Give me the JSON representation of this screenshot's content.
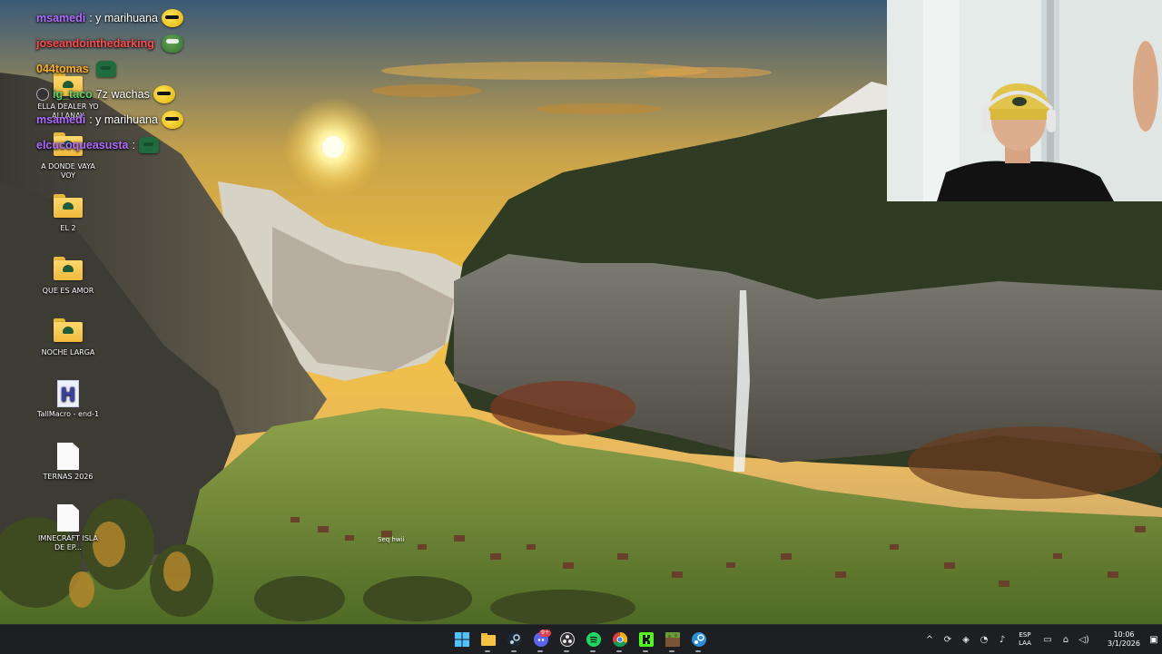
{
  "desktop": {
    "icons": [
      {
        "label": "ELLA DEALER YO ALLANAY",
        "type": "folder"
      },
      {
        "label": "A DONDE VAYA VOY",
        "type": "folder"
      },
      {
        "label": "EL 2",
        "type": "folder"
      },
      {
        "label": "QUE ES AMOR",
        "type": "folder"
      },
      {
        "label": "NOCHE LARGA",
        "type": "folder"
      },
      {
        "label": "TallMacro - end-1",
        "type": "app"
      },
      {
        "label": "TERNAS 2026",
        "type": "document"
      },
      {
        "label": "IMNECRAFT ISLA DE EP...",
        "type": "document"
      }
    ],
    "hover_tooltip": "Seq hwii"
  },
  "chat": {
    "messages": [
      {
        "user": "msamedi",
        "message": ": y marihuana",
        "user_color": "#b06bff",
        "emote": "sunglasses-emote"
      },
      {
        "user": "joseandointhedarking",
        "message": "",
        "user_color": "#ff4a4a",
        "emote": "pepe-emote"
      },
      {
        "user": "044tomas",
        "message": "",
        "user_color": "#ffb020",
        "emote": "cap-emote"
      },
      {
        "user": "ig_taco",
        "message": " 7z wachas",
        "user_color": "#58d36e",
        "emote": "sunglasses-emote"
      },
      {
        "user": "msamedi",
        "message": ": y marihuana",
        "user_color": "#b06bff",
        "emote": "sunglasses-emote"
      },
      {
        "user": "elcucoqueasusta",
        "message": ":",
        "user_color": "#b06bff",
        "emote": "cap-emote"
      }
    ]
  },
  "taskbar": {
    "apps": [
      {
        "name": "start-button",
        "color": "#3ba1ff"
      },
      {
        "name": "file-explorer-icon",
        "color": "#f6c443"
      },
      {
        "name": "steam-icon",
        "color": "#c7d5e0"
      },
      {
        "name": "discord-icon",
        "color": "#5865f2",
        "badge": "9+"
      },
      {
        "name": "obs-icon",
        "color": "#e6e6e6"
      },
      {
        "name": "spotify-icon",
        "color": "#1ed760"
      },
      {
        "name": "chrome-icon",
        "color": "#f2b705"
      },
      {
        "name": "kick-icon",
        "color": "#53fc18"
      },
      {
        "name": "minecraft-icon",
        "color": "#6f9a3a"
      },
      {
        "name": "steam-2-icon",
        "color": "#2a8fd8"
      }
    ],
    "tray": {
      "chevron": "^",
      "language_line1": "ESP",
      "language_line2": "LAA",
      "time": "10:06",
      "date": "3/1/2026"
    }
  }
}
